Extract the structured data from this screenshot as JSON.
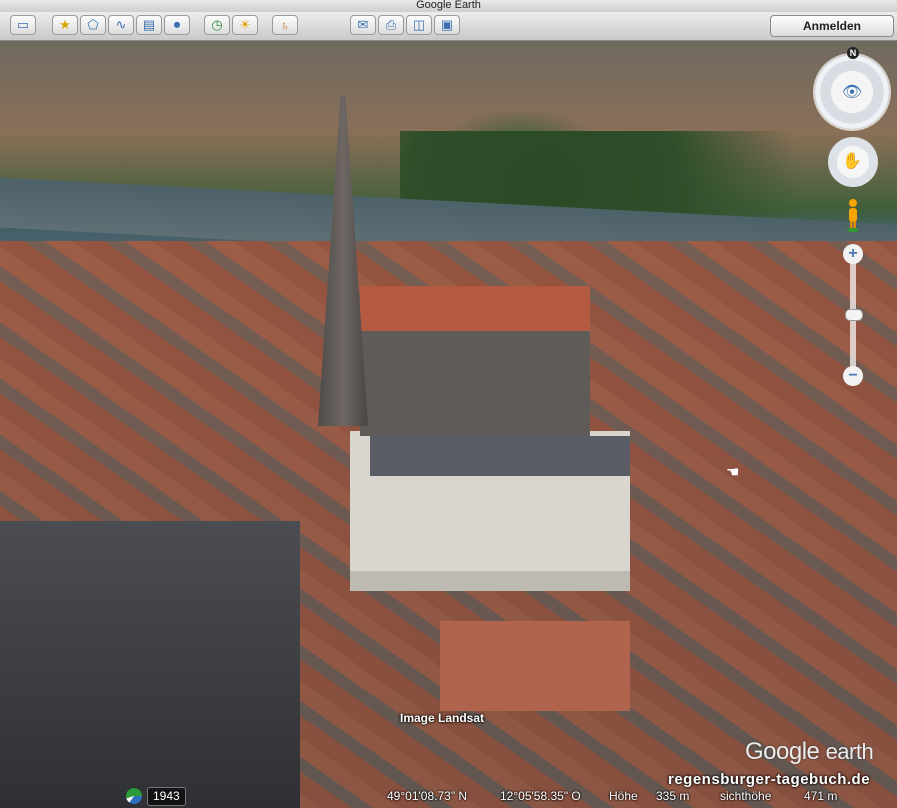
{
  "window": {
    "title": "Google Earth"
  },
  "toolbar": {
    "buttons": [
      {
        "name": "sidebar-toggle-button",
        "icon": "sidebar-icon",
        "glyph": "▭"
      },
      {
        "name": "add-placemark-button",
        "icon": "placemark-icon",
        "glyph": "★"
      },
      {
        "name": "add-polygon-button",
        "icon": "polygon-icon",
        "glyph": "⬠"
      },
      {
        "name": "add-path-button",
        "icon": "path-icon",
        "glyph": "∿"
      },
      {
        "name": "add-overlay-button",
        "icon": "image-overlay-icon",
        "glyph": "▤"
      },
      {
        "name": "record-tour-button",
        "icon": "record-tour-icon",
        "glyph": "⏺"
      },
      {
        "name": "historical-imagery-button",
        "icon": "clock-icon",
        "glyph": "◷"
      },
      {
        "name": "sunlight-button",
        "icon": "sun-icon",
        "glyph": "☀"
      },
      {
        "name": "switch-planet-button",
        "icon": "planet-icon",
        "glyph": "♄"
      },
      {
        "name": "email-button",
        "icon": "mail-icon",
        "glyph": "✉"
      },
      {
        "name": "print-button",
        "icon": "print-icon",
        "glyph": "⎙"
      },
      {
        "name": "view-in-maps-button",
        "icon": "maps-icon",
        "glyph": "◫"
      },
      {
        "name": "save-image-button",
        "icon": "save-image-icon",
        "glyph": "▣"
      }
    ],
    "login_label": "Anmelden"
  },
  "navigation": {
    "north_label": "N",
    "zoom_in": "+",
    "zoom_out": "−"
  },
  "map": {
    "image_credit": "Image Landsat",
    "logo_text_1": "Google",
    "logo_text_2": "earth",
    "source_url": "regensburger-tagebuch.de"
  },
  "status": {
    "year": "1943",
    "latitude": "49°01'08.73\" N",
    "longitude": "12°05'58.35\" O",
    "elevation_label": "Höhe",
    "elevation_value": "335 m",
    "eye_alt_label": "sichthöhe",
    "eye_alt_value": "471 m"
  },
  "colors": {
    "accent": "#3a6fb0",
    "roof_red": "#b35a41"
  }
}
